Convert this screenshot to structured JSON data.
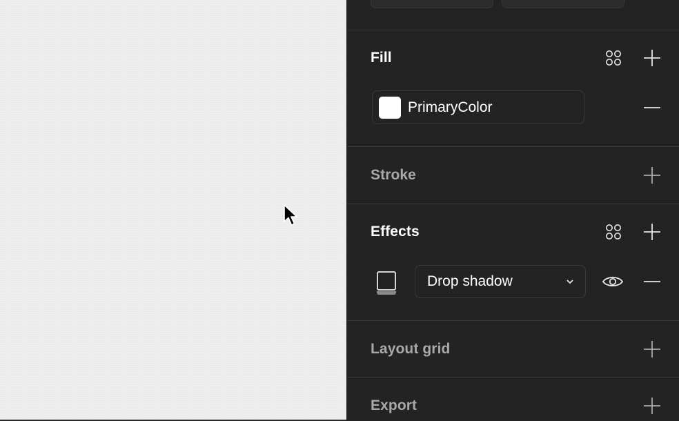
{
  "canvas": {
    "background": "#eeeeee"
  },
  "panel": {
    "fill": {
      "title": "Fill",
      "color_style": {
        "name": "PrimaryColor",
        "swatch_color": "#ffffff"
      },
      "icons": [
        "style-grid-icon",
        "plus-icon",
        "minus-icon"
      ]
    },
    "stroke": {
      "title": "Stroke",
      "icons": [
        "plus-icon"
      ]
    },
    "effects": {
      "title": "Effects",
      "effect_type": "Drop shadow",
      "icons": [
        "style-grid-icon",
        "plus-icon",
        "drop-shadow-icon",
        "chevron-down-icon",
        "eye-icon",
        "minus-icon"
      ]
    },
    "layout_grid": {
      "title": "Layout grid",
      "icons": [
        "plus-icon"
      ]
    },
    "export": {
      "title": "Export",
      "icons": [
        "plus-icon"
      ]
    }
  },
  "colors": {
    "panel_bg": "#232323",
    "divider": "#3a3a3a",
    "text_active": "#ffffff",
    "text_muted": "#a9a9a9"
  }
}
